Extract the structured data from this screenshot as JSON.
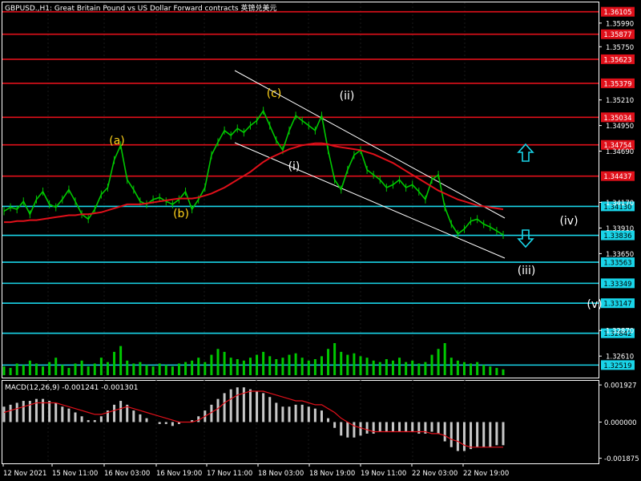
{
  "header": {
    "symbol_line": "GBPUSD.,H1: Great Britain Pound vs US Dollar Forward contracts 英镑兑美元"
  },
  "macd": {
    "label": "MACD(12,26,9) -0.001241 -0.001301"
  },
  "colors": {
    "background": "#000000",
    "axis": "#ffffff",
    "grid": "#1a1a1a",
    "resistance": "#e0101a",
    "support": "#19d4e8",
    "price": "#00c800",
    "ma": "#e0101a",
    "channel": "#ffffff",
    "volume": "#00c800",
    "histogram": "#c8c8c8",
    "signal": "#e0101a",
    "wave_yellow": "#ffd21a",
    "wave_white": "#ffffff",
    "arrow": "#19d4e8"
  },
  "chart_data": [
    {
      "type": "line",
      "title": "GBPUSD.,H1",
      "ylim": [
        1.324,
        1.362
      ],
      "y_ticks": [
        "1.35990",
        "1.35750",
        "1.35210",
        "1.34950",
        "1.34690",
        "1.34170",
        "1.33910",
        "1.33650",
        "1.32870",
        "1.32610"
      ],
      "x_ticks": [
        "12 Nov 2021",
        "15 Nov 11:00",
        "16 Nov 03:00",
        "16 Nov 19:00",
        "17 Nov 11:00",
        "18 Nov 03:00",
        "18 Nov 19:00",
        "19 Nov 11:00",
        "22 Nov 03:00",
        "22 Nov 19:00"
      ],
      "resistance_levels": [
        "1.36105",
        "1.35877",
        "1.35623",
        "1.35379",
        "1.35034",
        "1.34754",
        "1.34437"
      ],
      "support_levels": [
        "1.34130",
        "1.33836",
        "1.33563",
        "1.33349",
        "1.33147",
        "1.32842",
        "1.32519"
      ],
      "series": [
        {
          "values": [
            1.3408,
            1.3412,
            1.341,
            1.3418,
            1.3405,
            1.342,
            1.3428,
            1.3415,
            1.3412,
            1.342,
            1.343,
            1.3418,
            1.3405,
            1.34,
            1.341,
            1.3425,
            1.3432,
            1.346,
            1.3475,
            1.344,
            1.343,
            1.3418,
            1.3415,
            1.342,
            1.3422,
            1.3418,
            1.3415,
            1.342,
            1.3428,
            1.341,
            1.342,
            1.3432,
            1.3465,
            1.3478,
            1.349,
            1.3485,
            1.3492,
            1.3488,
            1.3495,
            1.35,
            1.351,
            1.3495,
            1.348,
            1.347,
            1.349,
            1.3505,
            1.35,
            1.3495,
            1.349,
            1.3505,
            1.347,
            1.344,
            1.343,
            1.345,
            1.3465,
            1.347,
            1.345,
            1.3445,
            1.344,
            1.3432,
            1.3435,
            1.344,
            1.3432,
            1.3435,
            1.3428,
            1.342,
            1.344,
            1.3445,
            1.3412,
            1.3395,
            1.3385,
            1.339,
            1.3398,
            1.34,
            1.3395,
            1.3392,
            1.3388,
            1.3384
          ]
        },
        {
          "values": [
            1.3397,
            1.3397,
            1.3398,
            1.3398,
            1.3399,
            1.3399,
            1.34,
            1.3401,
            1.3402,
            1.3403,
            1.3404,
            1.3404,
            1.3405,
            1.3405,
            1.3406,
            1.3407,
            1.3409,
            1.3411,
            1.3413,
            1.3415,
            1.3415,
            1.3415,
            1.3416,
            1.3417,
            1.3418,
            1.3419,
            1.342,
            1.3421,
            1.3421,
            1.3421,
            1.3422,
            1.3424,
            1.3426,
            1.3429,
            1.3432,
            1.3436,
            1.344,
            1.3444,
            1.3448,
            1.3453,
            1.3458,
            1.3462,
            1.3465,
            1.3468,
            1.3471,
            1.3473,
            1.3475,
            1.3476,
            1.3477,
            1.3477,
            1.3476,
            1.3474,
            1.3473,
            1.3472,
            1.3471,
            1.347,
            1.3468,
            1.3466,
            1.3463,
            1.346,
            1.3457,
            1.3453,
            1.3449,
            1.3445,
            1.3441,
            1.3437,
            1.3433,
            1.3429,
            1.3426,
            1.3423,
            1.342,
            1.3418,
            1.3416,
            1.3414,
            1.3413,
            1.3412,
            1.3411,
            1.341
          ]
        }
      ],
      "annotations": [
        "(a)",
        "(b)",
        "(c)",
        "(i)",
        "(ii)",
        "(iii)",
        "(iv)",
        "(v)"
      ]
    },
    {
      "type": "bar",
      "values": [
        6,
        5,
        8,
        7,
        10,
        8,
        6,
        9,
        12,
        7,
        5,
        8,
        10,
        6,
        8,
        12,
        9,
        16,
        20,
        10,
        8,
        9,
        7,
        6,
        8,
        7,
        6,
        8,
        9,
        10,
        12,
        9,
        14,
        18,
        16,
        12,
        11,
        10,
        12,
        14,
        16,
        13,
        11,
        12,
        14,
        15,
        12,
        10,
        11,
        13,
        18,
        22,
        16,
        14,
        15,
        13,
        12,
        10,
        9,
        11,
        10,
        12,
        9,
        10,
        8,
        9,
        14,
        18,
        22,
        12,
        10,
        9,
        8,
        9,
        7,
        6,
        5,
        4
      ]
    },
    {
      "type": "bar",
      "title": "MACD(12,26,9)",
      "y_ticks": [
        "0.001927",
        "0.000000",
        "-0.001875"
      ],
      "ylim": [
        -0.0021,
        0.0021
      ],
      "series": [
        {
          "values": [
            0.0008,
            0.0009,
            0.001,
            0.0011,
            0.0011,
            0.0012,
            0.0012,
            0.0011,
            0.001,
            0.0008,
            0.0007,
            0.0005,
            0.0003,
            0.0001,
            0.0001,
            0.0003,
            0.0006,
            0.0009,
            0.0011,
            0.0009,
            0.0006,
            0.0004,
            0.0002,
            0.0,
            -0.0001,
            -0.0001,
            -0.0002,
            -0.0001,
            0.0,
            0.0001,
            0.0003,
            0.0006,
            0.0009,
            0.0012,
            0.0015,
            0.0017,
            0.0018,
            0.0018,
            0.0017,
            0.0016,
            0.0015,
            0.0013,
            0.001,
            0.0008,
            0.0008,
            0.0009,
            0.0009,
            0.0008,
            0.0007,
            0.0006,
            0.0002,
            -0.0003,
            -0.0007,
            -0.0008,
            -0.0008,
            -0.0007,
            -0.0006,
            -0.0006,
            -0.0005,
            -0.0005,
            -0.0005,
            -0.0005,
            -0.0005,
            -0.0005,
            -0.0006,
            -0.0006,
            -0.0005,
            -0.0006,
            -0.001,
            -0.0013,
            -0.0015,
            -0.0015,
            -0.0014,
            -0.0013,
            -0.0013,
            -0.0013,
            -0.0012,
            -0.0012
          ]
        },
        {
          "values": [
            0.0005,
            0.0006,
            0.0007,
            0.0008,
            0.0009,
            0.001,
            0.001,
            0.001,
            0.001,
            0.0009,
            0.0008,
            0.0007,
            0.0006,
            0.0005,
            0.0004,
            0.0004,
            0.0005,
            0.0006,
            0.0007,
            0.0008,
            0.0007,
            0.0006,
            0.0005,
            0.0004,
            0.0003,
            0.0002,
            0.0001,
            0.0,
            0.0,
            0.0,
            0.0001,
            0.0003,
            0.0005,
            0.0007,
            0.001,
            0.0012,
            0.0014,
            0.0015,
            0.0016,
            0.0016,
            0.0016,
            0.0015,
            0.0014,
            0.0013,
            0.0012,
            0.0011,
            0.0011,
            0.001,
            0.0009,
            0.0009,
            0.0007,
            0.0005,
            0.0002,
            0.0,
            -0.0002,
            -0.0003,
            -0.0004,
            -0.0005,
            -0.0005,
            -0.0005,
            -0.0005,
            -0.0005,
            -0.0005,
            -0.0005,
            -0.0005,
            -0.0005,
            -0.0006,
            -0.0006,
            -0.0007,
            -0.0009,
            -0.001,
            -0.0012,
            -0.0013,
            -0.0013,
            -0.0013,
            -0.0013,
            -0.0013,
            -0.0013
          ]
        }
      ]
    }
  ]
}
